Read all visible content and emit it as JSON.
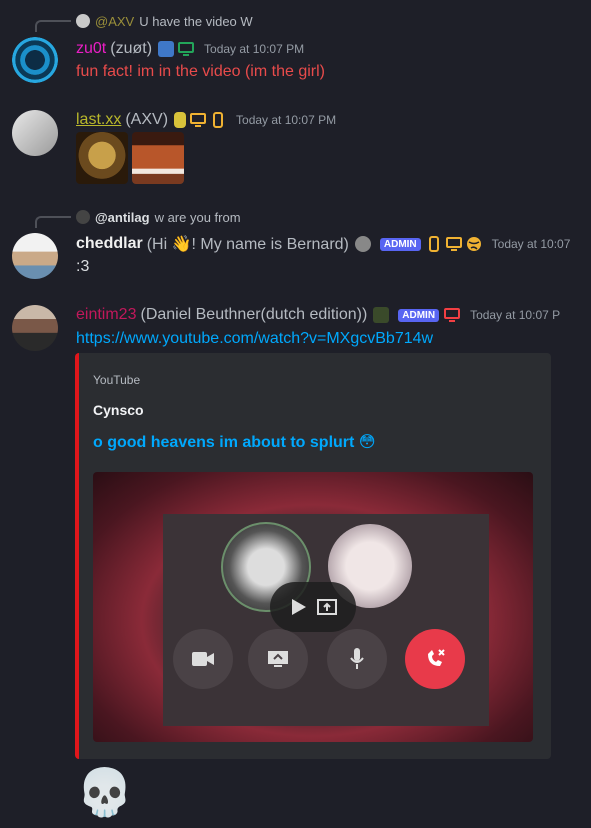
{
  "messages": [
    {
      "reply": {
        "user": "@AXV",
        "text": "U have the video W"
      },
      "username": "zu0t",
      "display": "(zuøt)",
      "timestamp": "Today at 10:07 PM",
      "content": "fun fact! im in the video (im the girl)",
      "name_color": "#e91ec4",
      "content_color": "#e84b4b"
    },
    {
      "username": "last.xx",
      "display": "(AXV)",
      "timestamp": "Today at 10:07 PM",
      "name_color": "#b9b82b",
      "emoji_count": 2
    },
    {
      "reply": {
        "user": "@antilag",
        "text": "w are you from"
      },
      "username": "cheddlar",
      "display": "(Hi 👋! My name is Bernard)",
      "badge": "ADMIN",
      "timestamp": "Today at 10:07",
      "content": ":3",
      "name_color": "#f0f0f0"
    },
    {
      "username": "eintim23",
      "display": "(Daniel Beuthner(dutch edition))",
      "badge": "ADMIN",
      "timestamp": "Today at 10:07 P",
      "content": "https://www.youtube.com/watch?v=MXgcvBb714w",
      "name_color": "#c2185b",
      "embed": {
        "provider": "YouTube",
        "author": "Cynsco",
        "title": "o good heavens im about to splurt 😳",
        "accent": "#e0161b"
      }
    }
  ],
  "reaction_emoji": "💀"
}
